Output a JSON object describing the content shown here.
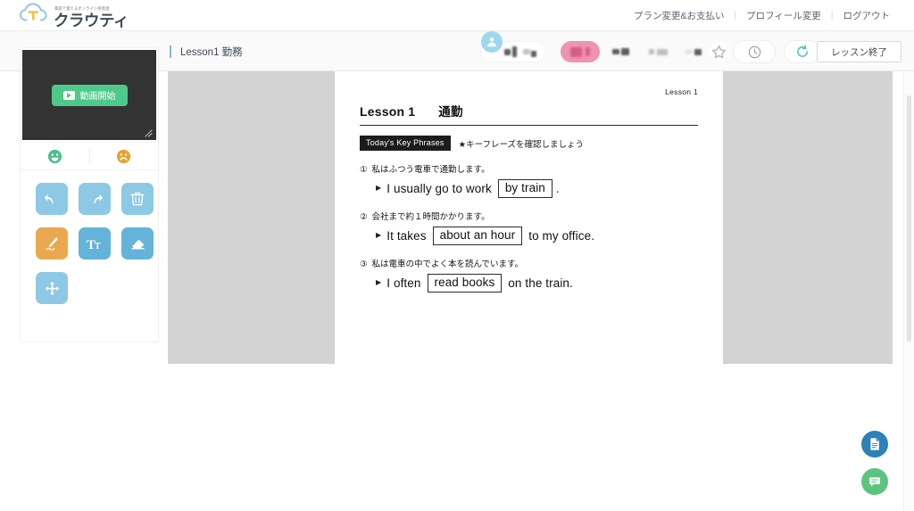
{
  "header": {
    "logo": {
      "tagline": "家庭で使えるオンライン英会話",
      "name": "クラウティ",
      "icon": "cloud-logo-icon"
    },
    "nav": [
      {
        "label": "プラン変更&お支払い",
        "name": "nav-plan-payment"
      },
      {
        "label": "プロフィール変更",
        "name": "nav-profile-edit"
      },
      {
        "label": "ログアウト",
        "name": "nav-logout"
      }
    ],
    "nav_separator": "|"
  },
  "subbar": {
    "lesson_title": "Lesson1 勤務",
    "avatar_icon": "person-avatar-icon",
    "student_name_redacted": "",
    "teacher_badge_redacted": "",
    "star_icon": "star-icon",
    "timer_icon": "clock-icon",
    "refresh_icon": "refresh-icon",
    "finish_label": "レッスン終了"
  },
  "sidebar": {
    "video": {
      "start_label": "動画開始",
      "play_icon": "play-icon",
      "resize_icon": "resize-handle-icon"
    },
    "reactions": [
      {
        "name": "reaction-happy",
        "icon": "smiling-face-icon",
        "color": "#4cc08a"
      },
      {
        "name": "reaction-sad",
        "icon": "frowning-face-icon",
        "color": "#e8a22e"
      }
    ],
    "tools": [
      {
        "name": "tool-undo",
        "icon": "undo-arrow-icon",
        "style": "tb-light"
      },
      {
        "name": "tool-redo",
        "icon": "redo-arrow-icon",
        "style": "tb-light"
      },
      {
        "name": "tool-delete",
        "icon": "trash-icon",
        "style": "tb-light"
      },
      {
        "name": "tool-pen",
        "icon": "pen-icon",
        "style": "tb-orange"
      },
      {
        "name": "tool-text",
        "icon": "text-tt-icon",
        "style": "tb-mid"
      },
      {
        "name": "tool-eraser",
        "icon": "eraser-icon",
        "style": "tb-mid"
      },
      {
        "name": "tool-move",
        "icon": "move-arrows-icon",
        "style": "tb-light"
      }
    ]
  },
  "lesson_page": {
    "corner_label": "Lesson 1",
    "heading_en": "Lesson 1",
    "heading_jp": "通勤",
    "keyphrase_badge": "Today's Key Phrases",
    "keyphrase_text": "★キーフレーズを確認しましょう",
    "items": [
      {
        "num": "①",
        "jp": "私はふつう電車で通勤します。",
        "en_before": "I usually go to work",
        "en_box": "by train",
        "en_after": "."
      },
      {
        "num": "②",
        "jp": "会社まで約１時間かかります。",
        "en_before": "It takes",
        "en_box": "about an hour",
        "en_after": "to my office."
      },
      {
        "num": "③",
        "jp": "私は電車の中でよく本を読んでいます。",
        "en_before": "I often",
        "en_box": "read books",
        "en_after": "on the train."
      }
    ]
  },
  "fabs": [
    {
      "name": "fab-document",
      "icon": "document-icon",
      "color": "#2d80b8"
    },
    {
      "name": "fab-chat",
      "icon": "chat-bubble-icon",
      "color": "#5cc47e"
    }
  ],
  "colors": {
    "accent_blue": "#7fb8d4",
    "pink_badge": "#ef93b4",
    "green_start": "#4ec98a",
    "tool_orange": "#eaa94e"
  }
}
